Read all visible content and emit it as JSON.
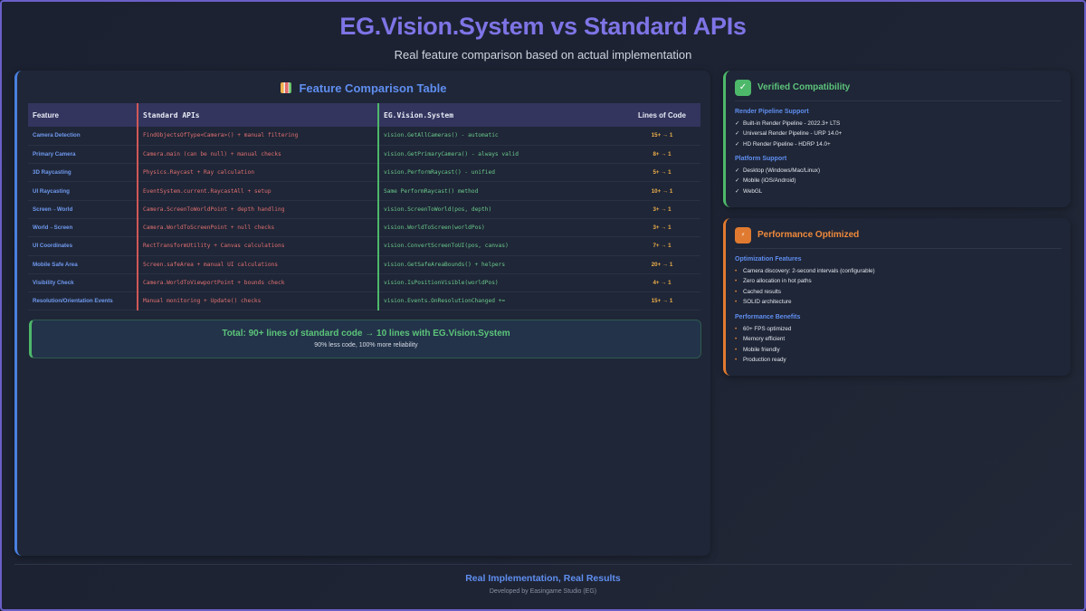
{
  "header": {
    "title": "EG.Vision.System vs Standard APIs",
    "subtitle": "Real feature comparison based on actual implementation"
  },
  "comparison": {
    "title": "Feature Comparison Table",
    "icon": "bar-chart-icon",
    "columns": [
      "Feature",
      "Standard APIs",
      "EG.Vision.System",
      "Lines of Code"
    ],
    "rows": [
      {
        "feature": "Camera Detection",
        "standard": "FindObjectsOfType<Camera>() + manual filtering",
        "eg": "vision.GetAllCameras() - automatic",
        "loc": "15+ → 1"
      },
      {
        "feature": "Primary Camera",
        "standard": "Camera.main (can be null) + manual checks",
        "eg": "vision.GetPrimaryCamera() - always valid",
        "loc": "8+ → 1"
      },
      {
        "feature": "3D Raycasting",
        "standard": "Physics.Raycast + Ray calculation",
        "eg": "vision.PerformRaycast() - unified",
        "loc": "5+ → 1"
      },
      {
        "feature": "UI Raycasting",
        "standard": "EventSystem.current.RaycastAll + setup",
        "eg": "Same PerformRaycast() method",
        "loc": "10+ → 1"
      },
      {
        "feature": "Screen→World",
        "standard": "Camera.ScreenToWorldPoint + depth handling",
        "eg": "vision.ScreenToWorld(pos, depth)",
        "loc": "3+ → 1"
      },
      {
        "feature": "World→Screen",
        "standard": "Camera.WorldToScreenPoint + null checks",
        "eg": "vision.WorldToScreen(worldPos)",
        "loc": "3+ → 1"
      },
      {
        "feature": "UI Coordinates",
        "standard": "RectTransformUtility + Canvas calculations",
        "eg": "vision.ConvertScreenToUI(pos, canvas)",
        "loc": "7+ → 1"
      },
      {
        "feature": "Mobile Safe Area",
        "standard": "Screen.safeArea + manual UI calculations",
        "eg": "vision.GetSafeAreaBounds() + helpers",
        "loc": "20+ → 1"
      },
      {
        "feature": "Visibility Check",
        "standard": "Camera.WorldToViewportPoint + bounds check",
        "eg": "vision.IsPositionVisible(worldPos)",
        "loc": "4+ → 1"
      },
      {
        "feature": "Resolution/Orientation Events",
        "standard": "Manual monitoring + Update() checks",
        "eg": "vision.Events.OnResolutionChanged +=",
        "loc": "15+ → 1"
      }
    ],
    "total_title": "Total: 90+ lines of standard code → 10 lines with EG.Vision.System",
    "total_sub": "90% less code, 100% more reliability"
  },
  "compatibility": {
    "badge": "✓",
    "title": "Verified Compatibility",
    "render_title": "Render Pipeline Support",
    "render_items": [
      "Built-in Render Pipeline - 2022.3+ LTS",
      "Universal Render Pipeline - URP 14.0+",
      "HD Render Pipeline - HDRP 14.0+"
    ],
    "platform_title": "Platform Support",
    "platform_items": [
      "Desktop (Windows/Mac/Linux)",
      "Mobile (iOS/Android)",
      "WebGL"
    ],
    "check": "✓"
  },
  "performance": {
    "badge_icon": "lightning-icon",
    "title": "Performance Optimized",
    "features_title": "Optimization Features",
    "features": [
      "Camera discovery: 2-second intervals (configurable)",
      "Zero allocation in hot paths",
      "Cached results",
      "SOLID architecture"
    ],
    "benefits_title": "Performance Benefits",
    "benefits": [
      "60+ FPS optimized",
      "Memory efficient",
      "Mobile friendly",
      "Production ready"
    ],
    "bullet": "•"
  },
  "footer": {
    "title": "Real Implementation, Real Results",
    "subtitle": "Developed by Easingame Studio (EG)"
  },
  "colors": {
    "accent_purple": "#7f74e6",
    "accent_blue": "#5f8ef0",
    "standard_red": "#e07070",
    "eg_green": "#6ac98a",
    "loc_orange": "#f0b04a",
    "perf_orange": "#e07a30"
  }
}
